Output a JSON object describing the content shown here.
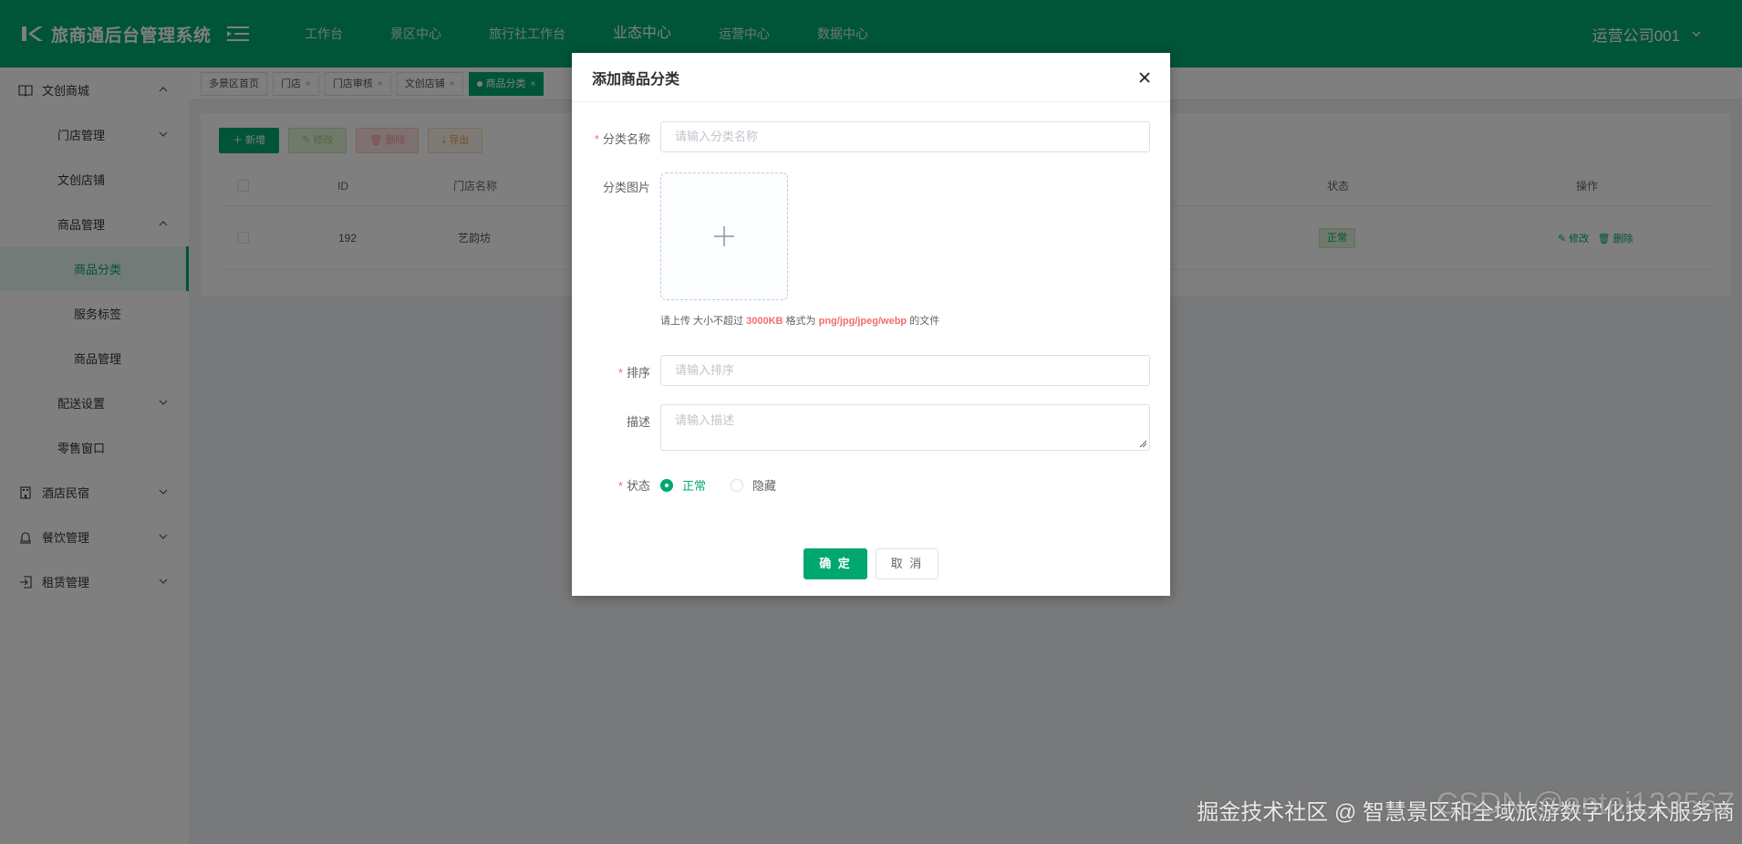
{
  "header": {
    "logo_text": "旅商通后台管理系统",
    "nav": [
      "工作台",
      "景区中心",
      "旅行社工作台",
      "业态中心",
      "运营中心",
      "数据中心"
    ],
    "active_nav": "业态中心",
    "user": "运营公司001"
  },
  "sidebar": {
    "items": [
      {
        "label": "文创商城",
        "icon": "book-icon",
        "level": 1,
        "expanded": true
      },
      {
        "label": "门店管理",
        "level": 2,
        "chevron": "down"
      },
      {
        "label": "文创店铺",
        "level": 2
      },
      {
        "label": "商品管理",
        "level": 2,
        "chevron": "up"
      },
      {
        "label": "商品分类",
        "level": 3,
        "active": true
      },
      {
        "label": "服务标签",
        "level": 3
      },
      {
        "label": "商品管理",
        "level": 3
      },
      {
        "label": "配送设置",
        "level": 2,
        "chevron": "down"
      },
      {
        "label": "零售窗口",
        "level": 2
      },
      {
        "label": "酒店民宿",
        "icon": "building-icon",
        "level": 1
      },
      {
        "label": "餐饮管理",
        "icon": "bell-icon",
        "level": 1
      },
      {
        "label": "租赁管理",
        "icon": "login-icon",
        "level": 1
      }
    ]
  },
  "tabs": [
    "多景区首页",
    "门店",
    "门店审核",
    "文创店铺",
    "商品分类"
  ],
  "toolbar": {
    "add": "新增",
    "edit": "修改",
    "delete": "删除",
    "export": "导出"
  },
  "table": {
    "headers": {
      "id": "ID",
      "store": "门店名称",
      "status": "状态",
      "ops": "操作"
    },
    "rows": [
      {
        "id": "192",
        "store": "艺韵坊",
        "status": "正常",
        "edit": "修改",
        "delete": "删除"
      }
    ]
  },
  "dialog": {
    "title": "添加商品分类",
    "name_label": "分类名称",
    "name_placeholder": "请输入分类名称",
    "image_label": "分类图片",
    "tip_prefix": "请上传 大小不超过",
    "tip_size": "3000KB",
    "tip_mid": "格式为",
    "tip_formats": "png/jpg/jpeg/webp",
    "tip_suffix": "的文件",
    "sort_label": "排序",
    "sort_placeholder": "请输入排序",
    "desc_label": "描述",
    "desc_placeholder": "请输入描述",
    "status_label": "状态",
    "status_options": [
      "正常",
      "隐藏"
    ],
    "status_selected": "正常",
    "ok": "确 定",
    "cancel": "取 消"
  },
  "watermark": {
    "main": "掘金技术社区 @ 智慧景区和全域旅游数字化技术服务商",
    "secondary": "CSDN @antai123567"
  },
  "colors": {
    "primary": "#00a870",
    "danger": "#f56c6c",
    "warning": "#e6a23c"
  }
}
